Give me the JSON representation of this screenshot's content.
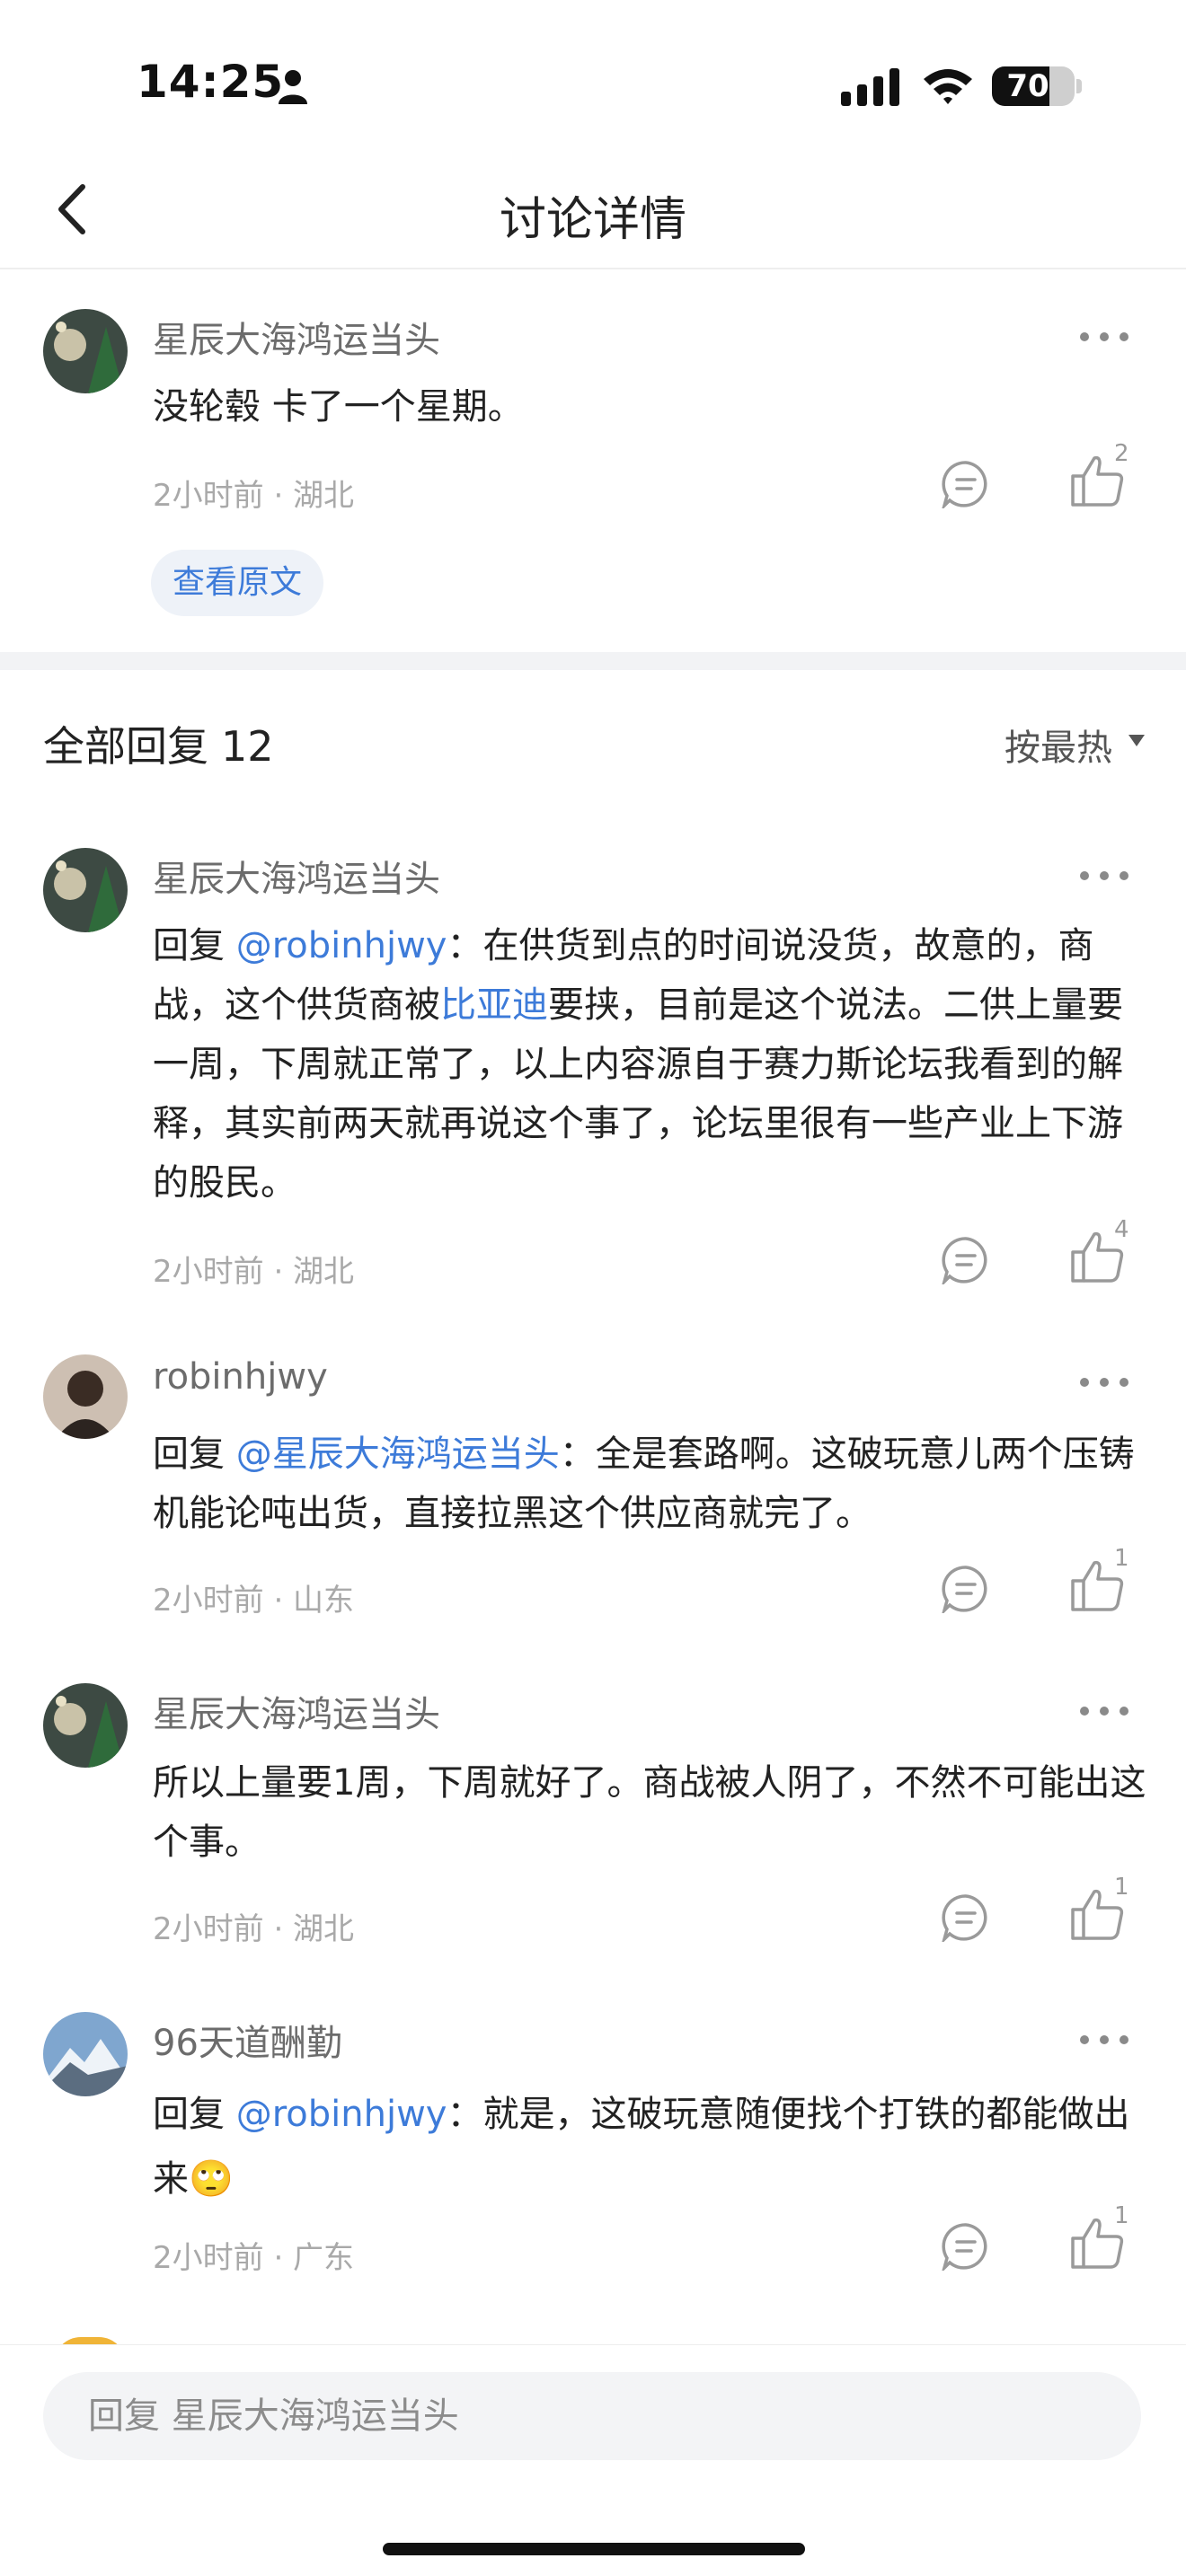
{
  "status_bar": {
    "time": "14:25",
    "battery": "70",
    "battery_level": 0.7
  },
  "nav": {
    "title": "讨论详情"
  },
  "post": {
    "username": "星辰大海鸿运当头",
    "text": "没轮毂 卡了一个星期。",
    "meta": "2小时前 · 湖北",
    "like_count": "2",
    "view_original": "查看原文"
  },
  "replies_header": {
    "title": "全部回复",
    "count": "12",
    "sort": "按最热"
  },
  "replies": [
    {
      "username": "星辰大海鸿运当头",
      "reply_prefix": "回复 ",
      "mention": "@robinhjwy",
      "text_a": "：在供货到点的时间说没货，故意的，商战，这个供货商被",
      "link": "比亚迪",
      "text_b": "要挟，目前是这个说法。二供上量要一周，下周就正常了，以上内容源自于赛力斯论坛我看到的解释，其实前两天就再说这个事了，论坛里很有一些产业上下游的股民。",
      "meta": "2小时前 · 湖北",
      "like_count": "4"
    },
    {
      "username": "robinhjwy",
      "reply_prefix": "回复 ",
      "mention": "@星辰大海鸿运当头",
      "text": "：全是套路啊。这破玩意儿两个压铸机能论吨出货，直接拉黑这个供应商就完了。",
      "meta": "2小时前 · 山东",
      "like_count": "1"
    },
    {
      "username": "星辰大海鸿运当头",
      "text": "所以上量要1周，下周就好了。商战被人阴了，不然不可能出这个事。",
      "meta": "2小时前 · 湖北",
      "like_count": "1"
    },
    {
      "username": "96天道酬勤",
      "reply_prefix": "回复 ",
      "mention": "@robinhjwy",
      "text": "：就是，这破玩意随便找个打铁的都能做出来",
      "emoji": "🙄",
      "meta": "2小时前 · 广东",
      "like_count": "1"
    }
  ],
  "bottom_bar": {
    "reply_placeholder": "回复 星辰大海鸿运当头"
  }
}
